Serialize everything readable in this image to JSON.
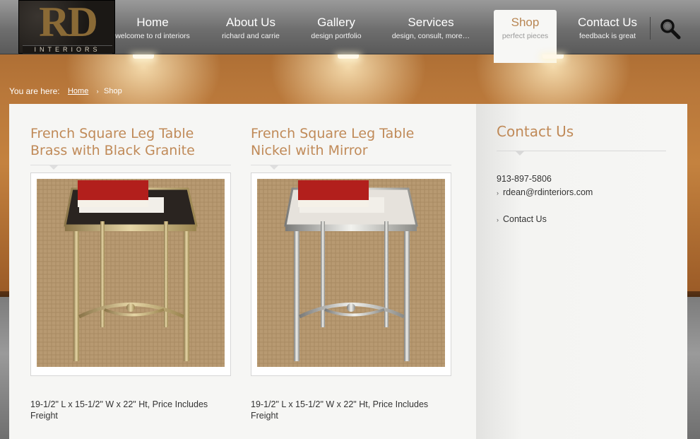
{
  "brand": {
    "logo_main": "RD",
    "logo_sub": "INTERIORS"
  },
  "nav": {
    "items": [
      {
        "label": "Home",
        "sub": "welcome to rd interiors"
      },
      {
        "label": "About Us",
        "sub": "richard and carrie"
      },
      {
        "label": "Gallery",
        "sub": "design portfolio"
      },
      {
        "label": "Services",
        "sub": "design, consult, more…"
      },
      {
        "label": "Shop",
        "sub": "perfect pieces"
      },
      {
        "label": "Contact Us",
        "sub": "feedback is great"
      }
    ],
    "active": "Shop",
    "search_icon": "magnifier-icon"
  },
  "breadcrumb": {
    "prefix": "You are here:",
    "home": "Home",
    "separator": "›",
    "current": "Shop"
  },
  "products": [
    {
      "title": "French Square Leg Table Brass with Black Granite",
      "title_line1": "French Square Leg Table",
      "title_line2": "Brass with Black Granite",
      "desc": "19-1/2\" L x 15-1/2\" W x 22\" Ht, Price Includes Freight"
    },
    {
      "title": "French Square Leg Table Nickel with Mirror",
      "title_line1": "French Square Leg Table",
      "title_line2": "Nickel with Mirror",
      "desc": "19-1/2\" L x 15-1/2\" W x 22\" Ht, Price Includes Freight"
    }
  ],
  "sidebar": {
    "title": "Contact Us",
    "phone": "913-897-5806",
    "email": "rdean@rdinteriors.com",
    "contact_link": "Contact Us",
    "bullet": "›"
  },
  "colors": {
    "accent": "#c08a58",
    "content_bg": "#f6f6f4",
    "header_gray": "#6e6e6e"
  }
}
